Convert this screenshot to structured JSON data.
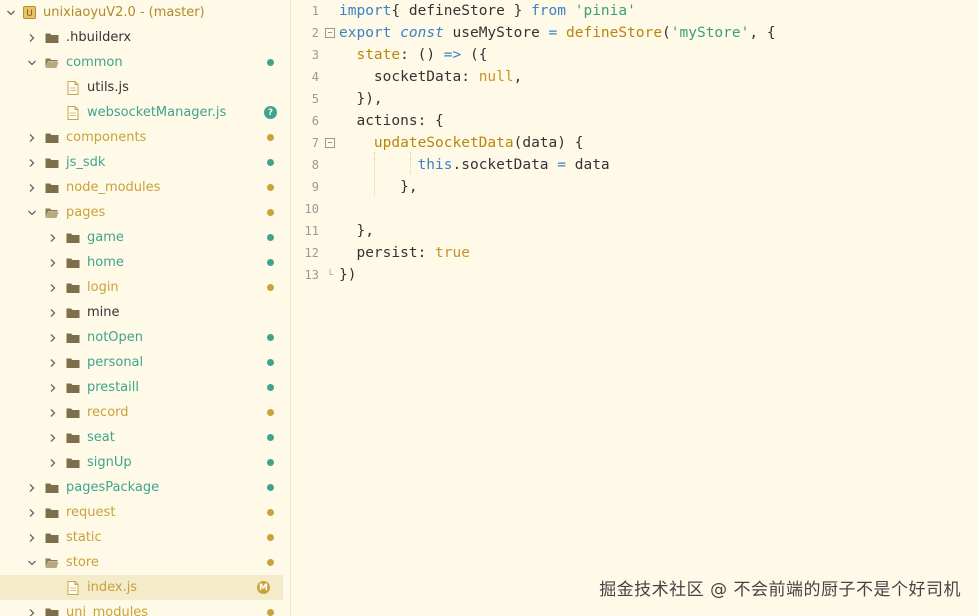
{
  "project": {
    "name": "unixiaoyuV2.0 - ",
    "branch": "(master)"
  },
  "colors": {
    "green": "#3fa38e",
    "gold": "#c8a23a",
    "selected": "#f3ebc9"
  },
  "tree": [
    {
      "label": ".hbuilderx",
      "type": "folder",
      "depth": 1,
      "expanded": false,
      "badge": ""
    },
    {
      "label": "common",
      "type": "folder",
      "depth": 1,
      "expanded": true,
      "badge": "green",
      "color": "green"
    },
    {
      "label": "utils.js",
      "type": "file",
      "depth": 2,
      "badge": ""
    },
    {
      "label": "websocketManager.js",
      "type": "file",
      "depth": 2,
      "badge": "question",
      "color": "green"
    },
    {
      "label": "components",
      "type": "folder",
      "depth": 1,
      "expanded": false,
      "badge": "gold",
      "color": "gold"
    },
    {
      "label": "js_sdk",
      "type": "folder",
      "depth": 1,
      "expanded": false,
      "badge": "green",
      "color": "green"
    },
    {
      "label": "node_modules",
      "type": "folder",
      "depth": 1,
      "expanded": false,
      "badge": "gold",
      "color": "gold"
    },
    {
      "label": "pages",
      "type": "folder",
      "depth": 1,
      "expanded": true,
      "badge": "gold",
      "color": "gold"
    },
    {
      "label": "game",
      "type": "folder",
      "depth": 2,
      "expanded": false,
      "badge": "green",
      "color": "green"
    },
    {
      "label": "home",
      "type": "folder",
      "depth": 2,
      "expanded": false,
      "badge": "green",
      "color": "green"
    },
    {
      "label": "login",
      "type": "folder",
      "depth": 2,
      "expanded": false,
      "badge": "gold",
      "color": "gold"
    },
    {
      "label": "mine",
      "type": "folder",
      "depth": 2,
      "expanded": false,
      "badge": ""
    },
    {
      "label": "notOpen",
      "type": "folder",
      "depth": 2,
      "expanded": false,
      "badge": "green",
      "color": "green"
    },
    {
      "label": "personal",
      "type": "folder",
      "depth": 2,
      "expanded": false,
      "badge": "green",
      "color": "green"
    },
    {
      "label": "prestaill",
      "type": "folder",
      "depth": 2,
      "expanded": false,
      "badge": "green",
      "color": "green"
    },
    {
      "label": "record",
      "type": "folder",
      "depth": 2,
      "expanded": false,
      "badge": "gold",
      "color": "gold"
    },
    {
      "label": "seat",
      "type": "folder",
      "depth": 2,
      "expanded": false,
      "badge": "green",
      "color": "green"
    },
    {
      "label": "signUp",
      "type": "folder",
      "depth": 2,
      "expanded": false,
      "badge": "green",
      "color": "green"
    },
    {
      "label": "pagesPackage",
      "type": "folder",
      "depth": 1,
      "expanded": false,
      "badge": "green",
      "color": "green"
    },
    {
      "label": "request",
      "type": "folder",
      "depth": 1,
      "expanded": false,
      "badge": "gold",
      "color": "gold"
    },
    {
      "label": "static",
      "type": "folder",
      "depth": 1,
      "expanded": false,
      "badge": "gold",
      "color": "gold"
    },
    {
      "label": "store",
      "type": "folder",
      "depth": 1,
      "expanded": true,
      "badge": "gold",
      "color": "gold"
    },
    {
      "label": "index.js",
      "type": "file",
      "depth": 2,
      "badge": "modified",
      "color": "gold",
      "selected": true
    },
    {
      "label": "uni_modules",
      "type": "folder",
      "depth": 1,
      "expanded": false,
      "badge": "gold",
      "color": "gold"
    }
  ],
  "badges": {
    "question": "?",
    "modified": "M"
  },
  "code_lines": [
    [
      [
        "kw",
        "import"
      ],
      [
        "",
        "{ defineStore } "
      ],
      [
        "kw",
        "from"
      ],
      [
        "",
        ""
      ],
      [
        "str",
        " 'pinia'"
      ]
    ],
    [
      [
        "kw",
        "export"
      ],
      [
        "",
        " "
      ],
      [
        "kwi",
        "const"
      ],
      [
        "",
        " useMyStore "
      ],
      [
        "kw",
        "="
      ],
      [
        "",
        " "
      ],
      [
        "fn",
        "defineStore"
      ],
      [
        "",
        "("
      ],
      [
        "str",
        "'myStore'"
      ],
      [
        "",
        ", {"
      ]
    ],
    [
      [
        "",
        "  "
      ],
      [
        "fn",
        "state"
      ],
      [
        "",
        ": () "
      ],
      [
        "kw",
        "=>"
      ],
      [
        "",
        " ({"
      ]
    ],
    [
      [
        "",
        "    socketData: "
      ],
      [
        "lit",
        "null"
      ],
      [
        "",
        ","
      ]
    ],
    [
      [
        "",
        "  }),"
      ]
    ],
    [
      [
        "",
        "  actions: {"
      ]
    ],
    [
      [
        "",
        "    "
      ],
      [
        "fn",
        "updateSocketData"
      ],
      [
        "",
        "(data) {"
      ]
    ],
    [
      [
        "",
        "         "
      ],
      [
        "kw",
        "this"
      ],
      [
        "",
        ".socketData "
      ],
      [
        "kw",
        "="
      ],
      [
        "",
        " data"
      ]
    ],
    [
      [
        "",
        "       },"
      ]
    ],
    [
      [
        "",
        ""
      ]
    ],
    [
      [
        "",
        "  },"
      ]
    ],
    [
      [
        "",
        "  persist: "
      ],
      [
        "lit",
        "true"
      ]
    ],
    [
      [
        "",
        "})"
      ]
    ]
  ],
  "fold_lines": [
    2,
    7,
    13
  ],
  "watermark": "掘金技术社区 @ 不会前端的厨子不是个好司机"
}
